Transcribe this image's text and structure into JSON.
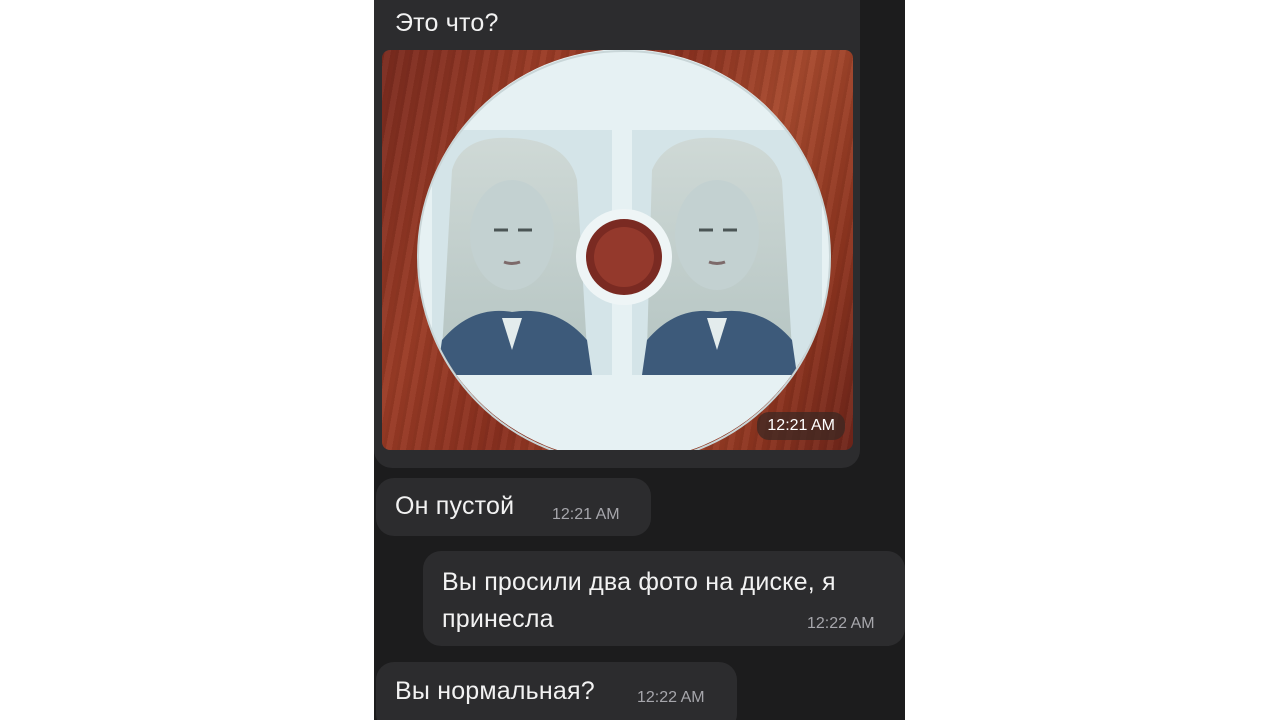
{
  "messages": [
    {
      "id": "m1",
      "text": "Это что?",
      "time": "12:21 AM",
      "has_photo": true
    },
    {
      "id": "m2",
      "text": "Он пустой",
      "time": "12:21 AM"
    },
    {
      "id": "m3",
      "text": "Вы просили два фото на диске, я принесла",
      "time": "12:22 AM"
    },
    {
      "id": "m4",
      "text": "Вы нормальная?",
      "time": "12:22 AM"
    }
  ],
  "photo": {
    "subject": "cd-with-two-passport-photos",
    "colors": {
      "wood": "#8a301f",
      "disc": "#e6f1f3",
      "hub": "#7a2a22"
    }
  }
}
